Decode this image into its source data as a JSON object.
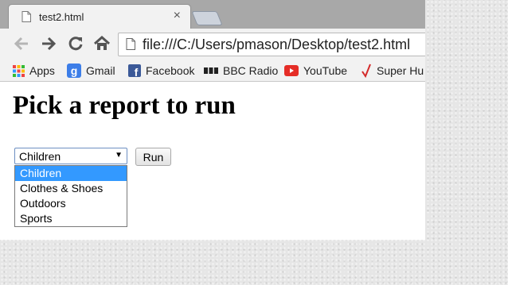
{
  "tab": {
    "title": "test2.html",
    "close_glyph": "×"
  },
  "toolbar": {
    "url": "file:///C:/Users/pmason/Desktop/test2.html"
  },
  "bookmarks": [
    {
      "label": "Apps",
      "icon": "apps-grid-icon"
    },
    {
      "label": "Gmail",
      "icon": "gmail-icon"
    },
    {
      "label": "Facebook",
      "icon": "facebook-icon"
    },
    {
      "label": "BBC Radio",
      "icon": "bbc-icon"
    },
    {
      "label": "YouTube",
      "icon": "youtube-icon"
    },
    {
      "label": "Super Hu",
      "icon": "check-mark-icon"
    }
  ],
  "page": {
    "heading": "Pick a report to run",
    "select": {
      "value": "Children",
      "arrow": "▼",
      "options": [
        "Children",
        "Clothes & Shoes",
        "Outdoors",
        "Sports"
      ]
    },
    "run_label": "Run"
  },
  "colors": {
    "selection": "#3399ff",
    "select_border": "#6d8fc2"
  }
}
